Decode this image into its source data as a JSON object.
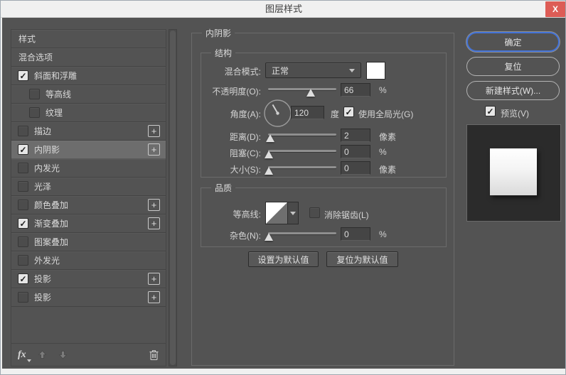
{
  "window": {
    "title": "图层样式"
  },
  "icons": {
    "close": "X",
    "check": "✓",
    "add": "+"
  },
  "sidebar": {
    "items": [
      {
        "label": "样式",
        "checkbox": false,
        "checked": false,
        "indent": false,
        "add": false,
        "selected": false
      },
      {
        "label": "混合选项",
        "checkbox": false,
        "checked": false,
        "indent": false,
        "add": false,
        "selected": false
      },
      {
        "label": "斜面和浮雕",
        "checkbox": true,
        "checked": true,
        "indent": false,
        "add": false,
        "selected": false
      },
      {
        "label": "等高线",
        "checkbox": true,
        "checked": false,
        "indent": true,
        "add": false,
        "selected": false
      },
      {
        "label": "纹理",
        "checkbox": true,
        "checked": false,
        "indent": true,
        "add": false,
        "selected": false
      },
      {
        "label": "描边",
        "checkbox": true,
        "checked": false,
        "indent": false,
        "add": true,
        "selected": false
      },
      {
        "label": "内阴影",
        "checkbox": true,
        "checked": true,
        "indent": false,
        "add": true,
        "selected": true
      },
      {
        "label": "内发光",
        "checkbox": true,
        "checked": false,
        "indent": false,
        "add": false,
        "selected": false
      },
      {
        "label": "光泽",
        "checkbox": true,
        "checked": false,
        "indent": false,
        "add": false,
        "selected": false
      },
      {
        "label": "颜色叠加",
        "checkbox": true,
        "checked": false,
        "indent": false,
        "add": true,
        "selected": false
      },
      {
        "label": "渐变叠加",
        "checkbox": true,
        "checked": true,
        "indent": false,
        "add": true,
        "selected": false
      },
      {
        "label": "图案叠加",
        "checkbox": true,
        "checked": false,
        "indent": false,
        "add": false,
        "selected": false
      },
      {
        "label": "外发光",
        "checkbox": true,
        "checked": false,
        "indent": false,
        "add": false,
        "selected": false
      },
      {
        "label": "投影",
        "checkbox": true,
        "checked": true,
        "indent": false,
        "add": true,
        "selected": false
      },
      {
        "label": "投影",
        "checkbox": true,
        "checked": false,
        "indent": false,
        "add": true,
        "selected": false
      }
    ],
    "toolbar": {
      "fx_label": "fx"
    }
  },
  "main": {
    "panel_title": "内阴影",
    "structure": {
      "group_label": "结构",
      "blend_mode": {
        "label": "混合模式:",
        "value": "正常",
        "swatch_color": "#ffffff"
      },
      "opacity": {
        "label": "不透明度(O):",
        "value": "66",
        "unit": "%",
        "percent": 63
      },
      "angle": {
        "label": "角度(A):",
        "value": "120",
        "unit": "度",
        "degrees": 120
      },
      "use_global_light": {
        "label": "使用全局光(G)",
        "checked": true
      },
      "distance": {
        "label": "距离(D):",
        "value": "2",
        "unit": "像素",
        "percent": 3
      },
      "choke": {
        "label": "阻塞(C):",
        "value": "0",
        "unit": "%",
        "percent": 1
      },
      "size": {
        "label": "大小(S):",
        "value": "0",
        "unit": "像素",
        "percent": 1
      }
    },
    "quality": {
      "group_label": "品质",
      "contour": {
        "label": "等高线:"
      },
      "anti_alias": {
        "label": "消除锯齿(L)",
        "checked": false
      },
      "noise": {
        "label": "杂色(N):",
        "value": "0",
        "unit": "%",
        "percent": 1
      }
    },
    "buttons": {
      "set_default": "设置为默认值",
      "reset_default": "复位为默认值"
    }
  },
  "actions": {
    "ok": "确定",
    "reset": "复位",
    "new_style": "新建样式(W)...",
    "preview": {
      "label": "预览(V)",
      "checked": true
    }
  },
  "colors": {
    "accent_blue": "#4272d8",
    "close_red": "#dd5c56",
    "dialog_bg": "#535353"
  }
}
